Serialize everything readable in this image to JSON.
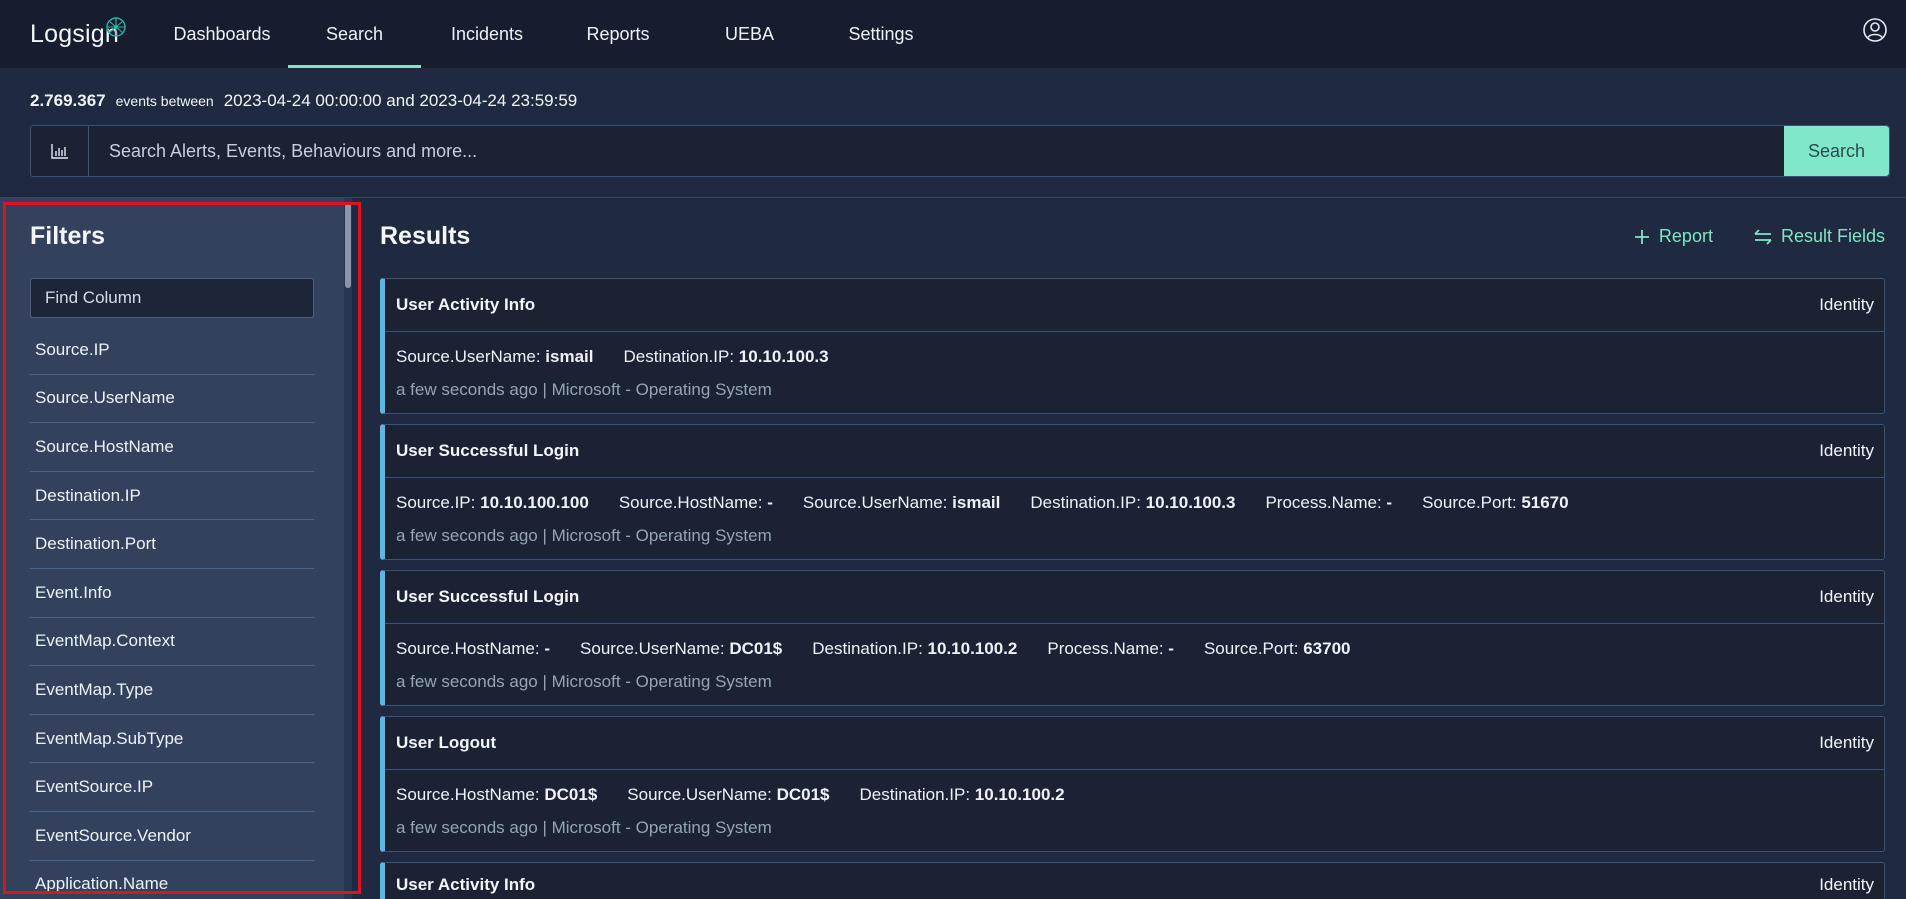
{
  "app": {
    "logo_text": "Logsign"
  },
  "nav": {
    "tabs": [
      {
        "label": "Dashboards"
      },
      {
        "label": "Search"
      },
      {
        "label": "Incidents"
      },
      {
        "label": "Reports"
      },
      {
        "label": "UEBA"
      },
      {
        "label": "Settings"
      }
    ],
    "active_tab": "Search"
  },
  "summary": {
    "count": "2.769.367",
    "between_label": "events between",
    "range": "2023-04-24 00:00:00 and 2023-04-24 23:59:59"
  },
  "search": {
    "placeholder": "Search Alerts, Events, Behaviours and more...",
    "button_label": "Search"
  },
  "filters": {
    "title": "Filters",
    "find_placeholder": "Find Column",
    "items": [
      "Source.IP",
      "Source.UserName",
      "Source.HostName",
      "Destination.IP",
      "Destination.Port",
      "Event.Info",
      "EventMap.Context",
      "EventMap.Type",
      "EventMap.SubType",
      "EventSource.IP",
      "EventSource.Vendor",
      "Application.Name"
    ]
  },
  "results": {
    "title": "Results",
    "report_label": "Report",
    "result_fields_label": "Result Fields",
    "cards": [
      {
        "title": "User Activity Info",
        "category": "Identity",
        "fields": [
          {
            "key": "Source.UserName:",
            "value": "ismail"
          },
          {
            "key": "Destination.IP:",
            "value": "10.10.100.3"
          }
        ],
        "meta": "a few seconds ago | Microsoft - Operating System"
      },
      {
        "title": "User Successful Login",
        "category": "Identity",
        "fields": [
          {
            "key": "Source.IP:",
            "value": "10.10.100.100"
          },
          {
            "key": "Source.HostName:",
            "value": "-"
          },
          {
            "key": "Source.UserName:",
            "value": "ismail"
          },
          {
            "key": "Destination.IP:",
            "value": "10.10.100.3"
          },
          {
            "key": "Process.Name:",
            "value": "-"
          },
          {
            "key": "Source.Port:",
            "value": "51670"
          }
        ],
        "meta": "a few seconds ago | Microsoft - Operating System"
      },
      {
        "title": "User Successful Login",
        "category": "Identity",
        "fields": [
          {
            "key": "Source.HostName:",
            "value": "-"
          },
          {
            "key": "Source.UserName:",
            "value": "DC01$"
          },
          {
            "key": "Destination.IP:",
            "value": "10.10.100.2"
          },
          {
            "key": "Process.Name:",
            "value": "-"
          },
          {
            "key": "Source.Port:",
            "value": "63700"
          }
        ],
        "meta": "a few seconds ago | Microsoft - Operating System"
      },
      {
        "title": "User Logout",
        "category": "Identity",
        "fields": [
          {
            "key": "Source.HostName:",
            "value": "DC01$"
          },
          {
            "key": "Source.UserName:",
            "value": "DC01$"
          },
          {
            "key": "Destination.IP:",
            "value": "10.10.100.2"
          }
        ],
        "meta": "a few seconds ago | Microsoft - Operating System"
      },
      {
        "title": "User Activity Info",
        "category": "Identity",
        "fields": [],
        "meta": ""
      }
    ]
  },
  "icons": {
    "logo": "network-globe-icon",
    "user": "user-circle-icon",
    "chart": "bar-chart-icon",
    "report": "plus-icon",
    "result_fields": "swap-arrows-icon"
  },
  "colors": {
    "accent": "#7ee6c7",
    "card_border_left": "#5fb4e6",
    "highlight": "#e0121a"
  }
}
